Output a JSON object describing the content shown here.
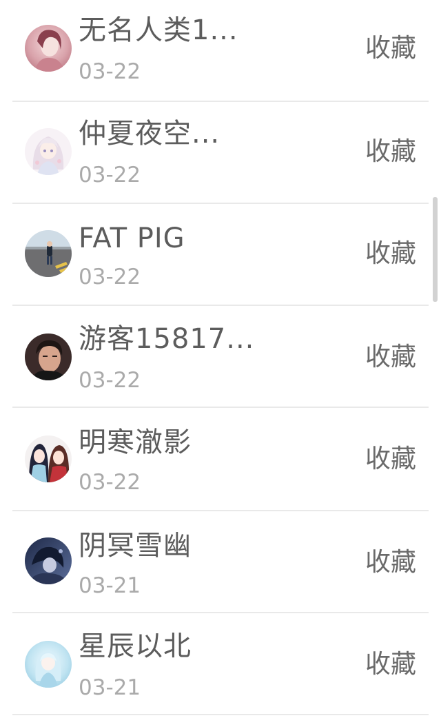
{
  "list": {
    "items": [
      {
        "name": "无名人类1...",
        "date": "03-22",
        "action": "收藏",
        "avatar": "girl-portrait-pink"
      },
      {
        "name": "仲夏夜空...",
        "date": "03-22",
        "action": "收藏",
        "avatar": "anime-girl-white"
      },
      {
        "name": "FAT PIG",
        "date": "03-22",
        "action": "收藏",
        "avatar": "person-on-parking-lot"
      },
      {
        "name": "游客15817...",
        "date": "03-22",
        "action": "收藏",
        "avatar": "young-man-dark"
      },
      {
        "name": "明寒澈影",
        "date": "03-22",
        "action": "收藏",
        "avatar": "anime-couple"
      },
      {
        "name": "阴冥雪幽",
        "date": "03-21",
        "action": "收藏",
        "avatar": "anime-dark-blue"
      },
      {
        "name": "星辰以北",
        "date": "03-21",
        "action": "收藏",
        "avatar": "anime-girl-ice-blue"
      }
    ]
  },
  "colors": {
    "name_text": "#5c5c5c",
    "date_text": "#aaaaaa",
    "action_text": "#6a6a6a",
    "divider": "#e9e9e9"
  }
}
